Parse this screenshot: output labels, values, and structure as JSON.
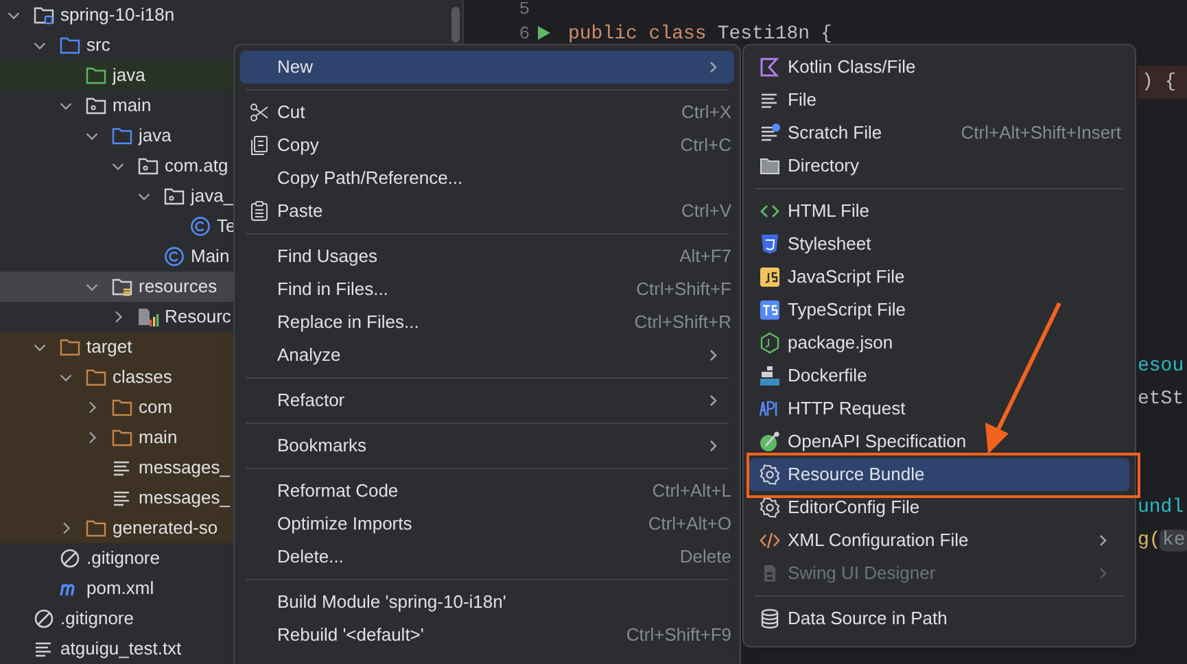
{
  "project_tree": [
    {
      "name": "spring-10-i18n",
      "kind": "module",
      "expanded": true,
      "selected": false,
      "excluded": false,
      "children": [
        {
          "name": "src",
          "kind": "folder",
          "expanded": true,
          "selected": false,
          "excluded": false,
          "children": [
            {
              "name": "java",
              "kind": "test_folder",
              "selected": false,
              "excluded": false
            },
            {
              "name": "main",
              "kind": "package",
              "expanded": true,
              "selected": false,
              "excluded": false,
              "children": [
                {
                  "name": "java",
                  "kind": "folder",
                  "expanded": true,
                  "selected": false,
                  "excluded": false,
                  "children": [
                    {
                      "name": "com.atg",
                      "kind": "package",
                      "expanded": true,
                      "selected": false,
                      "excluded": false,
                      "children": [
                        {
                          "name": "java_",
                          "kind": "package",
                          "expanded": true,
                          "selected": false,
                          "excluded": false,
                          "children": [
                            {
                              "name": "Te",
                              "kind": "class",
                              "selected": false,
                              "excluded": false
                            }
                          ]
                        },
                        {
                          "name": "Main",
                          "kind": "class",
                          "selected": false,
                          "excluded": false
                        }
                      ]
                    }
                  ]
                },
                {
                  "name": "resources",
                  "kind": "resources",
                  "expanded": true,
                  "selected": true,
                  "excluded": false,
                  "children": [
                    {
                      "name": "Resourc",
                      "kind": "bundle",
                      "expanded": false,
                      "selected": false,
                      "excluded": false
                    }
                  ]
                }
              ]
            }
          ]
        },
        {
          "name": "target",
          "kind": "folder",
          "expanded": true,
          "selected": false,
          "excluded": true,
          "children": [
            {
              "name": "classes",
              "kind": "folder",
              "expanded": true,
              "selected": false,
              "excluded": true,
              "children": [
                {
                  "name": "com",
                  "kind": "folder",
                  "expanded": false,
                  "selected": false,
                  "excluded": true
                },
                {
                  "name": "main",
                  "kind": "folder",
                  "expanded": false,
                  "selected": false,
                  "excluded": true
                },
                {
                  "name": "messages_",
                  "kind": "file",
                  "selected": false,
                  "excluded": true
                },
                {
                  "name": "messages_",
                  "kind": "file",
                  "selected": false,
                  "excluded": true
                }
              ]
            },
            {
              "name": "generated-so",
              "kind": "folder",
              "expanded": false,
              "selected": false,
              "excluded": true
            }
          ]
        },
        {
          "name": ".gitignore",
          "kind": "gitignore",
          "selected": false,
          "excluded": false
        },
        {
          "name": "pom.xml",
          "kind": "maven",
          "selected": false,
          "excluded": false
        }
      ]
    },
    {
      "name": ".gitignore",
      "kind": "gitignore",
      "selected": false,
      "excluded": false
    },
    {
      "name": "atguigu_test.txt",
      "kind": "file",
      "selected": false,
      "excluded": false
    }
  ],
  "editor": {
    "line_numbers": [
      "5",
      "6"
    ],
    "code_line": [
      {
        "text": "public class",
        "kind": "keyword"
      },
      {
        "text": "Testi18n",
        "kind": "class"
      },
      {
        "text": "{",
        "kind": "plain"
      }
    ],
    "fragments": [
      {
        "text": ") {",
        "kind": "plain"
      },
      {
        "text": "esou",
        "kind": "call"
      },
      {
        "text": "etSt",
        "kind": "plain"
      },
      {
        "text": "undl",
        "kind": "call"
      },
      {
        "text": "g(",
        "kind": "method"
      },
      {
        "text": "ke",
        "kind": "hint"
      }
    ]
  },
  "context_menu": {
    "groups": [
      [
        {
          "label": "New",
          "has_submenu": true,
          "selected": true
        }
      ],
      [
        {
          "label": "Cut",
          "shortcut": "Ctrl+X",
          "has_submenu": false,
          "selected": false
        },
        {
          "label": "Copy",
          "shortcut": "Ctrl+C",
          "has_submenu": false,
          "selected": false
        },
        {
          "label": "Copy Path/Reference...",
          "has_submenu": false,
          "selected": false
        },
        {
          "label": "Paste",
          "shortcut": "Ctrl+V",
          "has_submenu": false,
          "selected": false
        }
      ],
      [
        {
          "label": "Find Usages",
          "shortcut": "Alt+F7",
          "has_submenu": false,
          "selected": false
        },
        {
          "label": "Find in Files...",
          "shortcut": "Ctrl+Shift+F",
          "has_submenu": false,
          "selected": false
        },
        {
          "label": "Replace in Files...",
          "shortcut": "Ctrl+Shift+R",
          "has_submenu": false,
          "selected": false
        },
        {
          "label": "Analyze",
          "has_submenu": true,
          "selected": false
        }
      ],
      [
        {
          "label": "Refactor",
          "has_submenu": true,
          "selected": false
        }
      ],
      [
        {
          "label": "Bookmarks",
          "has_submenu": true,
          "selected": false
        }
      ],
      [
        {
          "label": "Reformat Code",
          "shortcut": "Ctrl+Alt+L",
          "has_submenu": false,
          "selected": false
        },
        {
          "label": "Optimize Imports",
          "shortcut": "Ctrl+Alt+O",
          "has_submenu": false,
          "selected": false
        },
        {
          "label": "Delete...",
          "shortcut": "Delete",
          "has_submenu": false,
          "selected": false
        }
      ],
      [
        {
          "label": "Build Module 'spring-10-i18n'",
          "has_submenu": false,
          "selected": false
        },
        {
          "label": "Rebuild '<default>'",
          "shortcut": "Ctrl+Shift+F9",
          "has_submenu": false,
          "selected": false
        }
      ]
    ]
  },
  "submenu": {
    "groups": [
      [
        {
          "label": "Kotlin Class/File",
          "has_submenu": false,
          "selected": false,
          "disabled": false
        },
        {
          "label": "File",
          "has_submenu": false,
          "selected": false,
          "disabled": false
        },
        {
          "label": "Scratch File",
          "shortcut": "Ctrl+Alt+Shift+Insert",
          "has_submenu": false,
          "selected": false,
          "disabled": false
        },
        {
          "label": "Directory",
          "has_submenu": false,
          "selected": false,
          "disabled": false
        }
      ],
      [
        {
          "label": "HTML File",
          "has_submenu": false,
          "selected": false,
          "disabled": false
        },
        {
          "label": "Stylesheet",
          "has_submenu": false,
          "selected": false,
          "disabled": false
        },
        {
          "label": "JavaScript File",
          "has_submenu": false,
          "selected": false,
          "disabled": false
        },
        {
          "label": "TypeScript File",
          "has_submenu": false,
          "selected": false,
          "disabled": false
        },
        {
          "label": "package.json",
          "has_submenu": false,
          "selected": false,
          "disabled": false
        },
        {
          "label": "Dockerfile",
          "has_submenu": false,
          "selected": false,
          "disabled": false
        },
        {
          "label": "HTTP Request",
          "has_submenu": false,
          "selected": false,
          "disabled": false
        },
        {
          "label": "OpenAPI Specification",
          "has_submenu": false,
          "selected": false,
          "disabled": false
        },
        {
          "label": "Resource Bundle",
          "has_submenu": false,
          "selected": true,
          "disabled": false
        },
        {
          "label": "EditorConfig File",
          "has_submenu": false,
          "selected": false,
          "disabled": false
        },
        {
          "label": "XML Configuration File",
          "has_submenu": true,
          "selected": false,
          "disabled": false
        },
        {
          "label": "Swing UI Designer",
          "has_submenu": true,
          "selected": false,
          "disabled": true
        }
      ],
      [
        {
          "label": "Data Source in Path",
          "has_submenu": false,
          "selected": false,
          "disabled": false
        }
      ]
    ]
  }
}
